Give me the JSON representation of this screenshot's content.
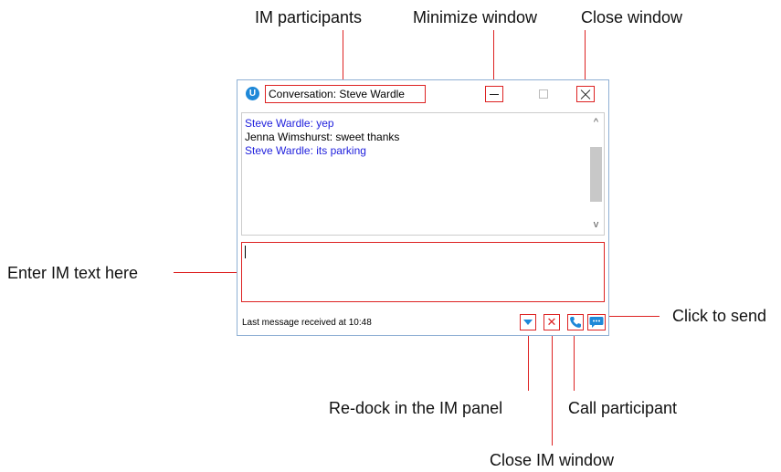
{
  "annotations": {
    "im_participants": "IM participants",
    "minimize_window": "Minimize window",
    "close_window": "Close window",
    "enter_im_text": "Enter IM text here",
    "click_to_send": "Click to send",
    "redock": "Re-dock in the IM panel",
    "call_participant": "Call participant",
    "close_im_window": "Close IM window"
  },
  "window": {
    "app_icon_letter": "U",
    "title": "Conversation: Steve Wardle"
  },
  "messages": [
    {
      "text": "Steve Wardle: yep",
      "color": "#2222dd"
    },
    {
      "text": "Jenna Wimshurst: sweet thanks",
      "color": "#000000"
    },
    {
      "text": "Steve Wardle: its parking",
      "color": "#2222dd"
    }
  ],
  "scrollbar": {
    "up_glyph": "^",
    "down_glyph": "v"
  },
  "status": {
    "last_message": "Last message received at 10:48"
  },
  "icons": {
    "redock": "triangle-down-icon",
    "close_im": "close-x-icon",
    "call": "phone-icon",
    "send": "chat-bubble-icon"
  },
  "colors": {
    "accent": "#1e88d8",
    "annotation": "#dd2222",
    "own_message": "#2222dd"
  }
}
